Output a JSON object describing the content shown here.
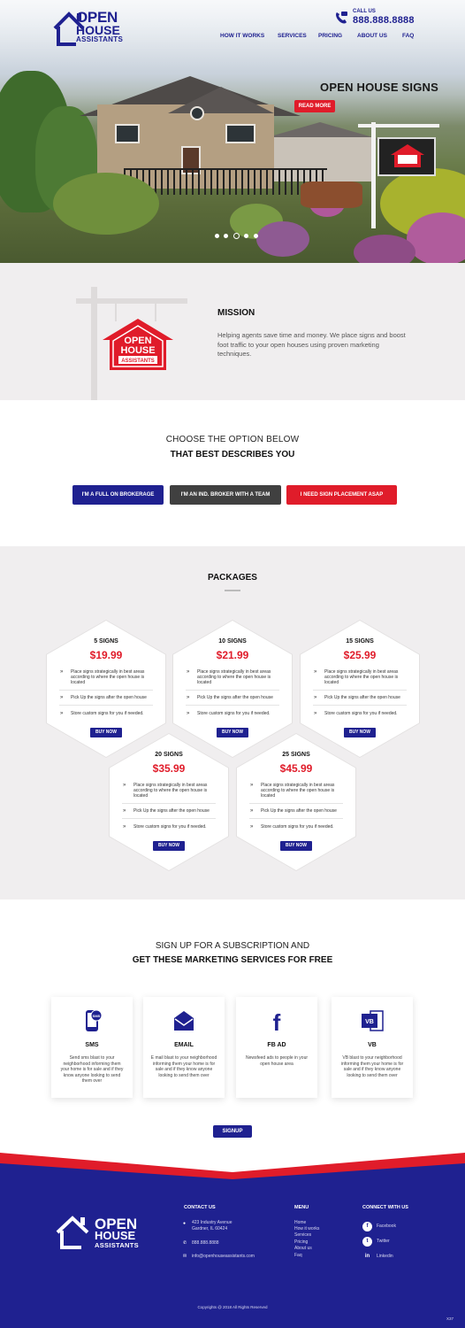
{
  "header": {
    "logo": {
      "line1": "OPEN",
      "line2": "HOUSE",
      "line3": "ASSISTANTS"
    },
    "call_label": "CALL US",
    "phone": "888.888.8888",
    "nav": [
      "HOW IT WORKS",
      "SERVICES",
      "PRICING",
      "ABOUT US",
      "FAQ"
    ]
  },
  "hero": {
    "title": "OPEN HOUSE SIGNS",
    "button": "READ MORE",
    "slide_count": 5,
    "active_slide": 3,
    "sign_text": {
      "line1": "OPEN",
      "line2": "HOUSE",
      "line3": "ASSISTANTS"
    }
  },
  "mission": {
    "title": "MISSION",
    "text": "Helping agents save time and money. We place signs and boost foot traffic to your open houses using proven marketing techniques.",
    "sign_text": {
      "line1": "OPEN",
      "line2": "HOUSE",
      "line3": "ASSISTANTS"
    }
  },
  "choose": {
    "line1": "CHOOSE THE OPTION BELOW",
    "line2": "THAT BEST DESCRIBES YOU",
    "options": [
      "I'M A FULL ON BROKERAGE",
      "I'M AN IND. BROKER WITH A TEAM",
      "I NEED SIGN PLACEMENT ASAP"
    ]
  },
  "packages": {
    "title": "PACKAGES",
    "items": [
      {
        "name": "5 SIGNS",
        "price": "$19.99"
      },
      {
        "name": "10 SIGNS",
        "price": "$21.99"
      },
      {
        "name": "15 SIGNS",
        "price": "$25.99"
      },
      {
        "name": "20 SIGNS",
        "price": "$35.99"
      },
      {
        "name": "25 SIGNS",
        "price": "$45.99"
      }
    ],
    "features": [
      "Place signs strategically in best areas according to where the open house is located",
      "Pick Up the signs after the open house",
      "Store custom signs for you if needed."
    ],
    "buy_label": "BUY NOW"
  },
  "signup": {
    "line1": "SIGN UP FOR A SUBSCRIPTION AND",
    "line2": "GET THESE MARKETING SERVICES FOR FREE",
    "cards": [
      {
        "title": "SMS",
        "icon": "sms-phone-icon",
        "icon_label": "SMS",
        "text": "Send sms blast to your neighborhood informing them your home is for sale and if they know anyone looking to send them over"
      },
      {
        "title": "EMAIL",
        "icon": "envelope-icon",
        "text": "E mail blast to your neighborhood informing them your home is for sale and if they know anyone looking to send them over"
      },
      {
        "title": "FB AD",
        "icon": "facebook-icon",
        "icon_label": "f",
        "text": "Newsfeed ads to people in your open house area"
      },
      {
        "title": "VB",
        "icon": "vb-icon",
        "icon_label": "VB",
        "text": "VB blast to your neighborhood informing them your home is for sale and if they know anyone looking to send them over"
      }
    ],
    "button": "SIGNUP"
  },
  "footer": {
    "logo": {
      "line1": "OPEN",
      "line2": "HOUSE",
      "line3": "ASSISTANTS"
    },
    "contact_title": "CONTACT US",
    "address1": "423 Industry Avenue",
    "address2": "Gardner, IL 60424",
    "phone": "888.888.8888",
    "email": "info@openhouseassistants.com",
    "menu_title": "MENU",
    "menu": [
      "Home",
      "How it works",
      "Services",
      "Pricing",
      "About us",
      "Faq"
    ],
    "connect_title": "CONNECT WITH US",
    "social": [
      {
        "label": "Facebook",
        "icon": "facebook-icon",
        "glyph": "f"
      },
      {
        "label": "Twitter",
        "icon": "twitter-icon",
        "glyph": "t"
      },
      {
        "label": "Linkedin",
        "icon": "linkedin-icon",
        "glyph": "in"
      }
    ],
    "copyright": "Copyrights @ 2018 All Rights Reserved",
    "tag": "X37"
  },
  "colors": {
    "primary": "#1f2190",
    "accent": "#e01c2a",
    "dark_button": "#404040",
    "section_bg": "#f0eeef"
  }
}
